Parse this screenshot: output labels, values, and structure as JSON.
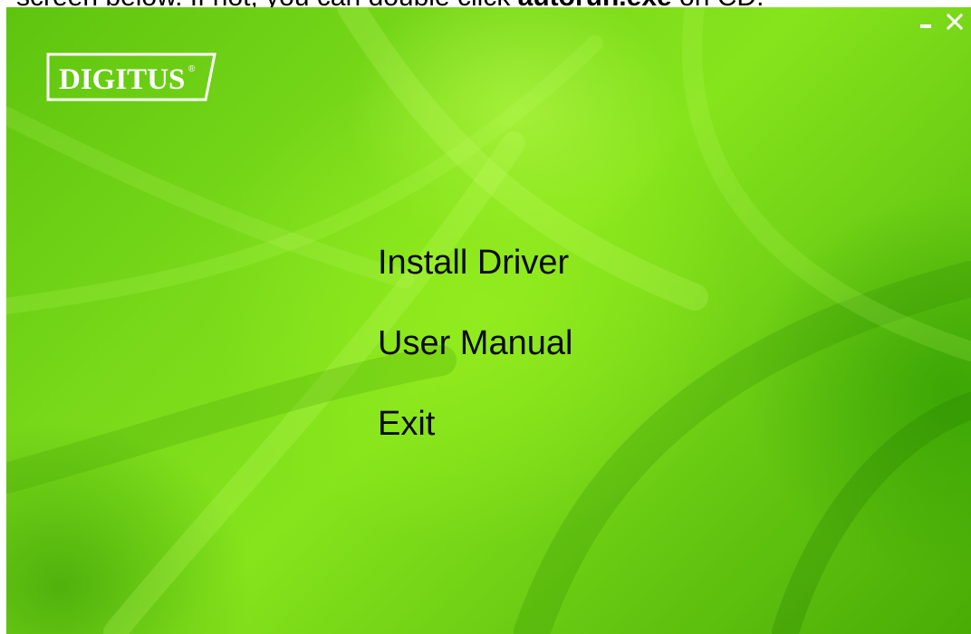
{
  "document": {
    "caption_prefix": "screen below. If not, you can double click ",
    "caption_emphasis": "autorun.exe",
    "caption_suffix": " on CD."
  },
  "window": {
    "logo_text": "DIGITUS",
    "logo_mark": "®",
    "controls": [
      {
        "icon": "minimize-icon"
      },
      {
        "icon": "close-icon"
      }
    ]
  },
  "menu": {
    "items": [
      {
        "label": "Install Driver"
      },
      {
        "label": "User Manual"
      },
      {
        "label": "Exit"
      }
    ]
  },
  "colors": {
    "background_light": "#86e41c",
    "background_dark": "#48ac05",
    "menu_text": "#0a0a0a",
    "logo": "#ffffff",
    "controls": "#ffffff"
  }
}
